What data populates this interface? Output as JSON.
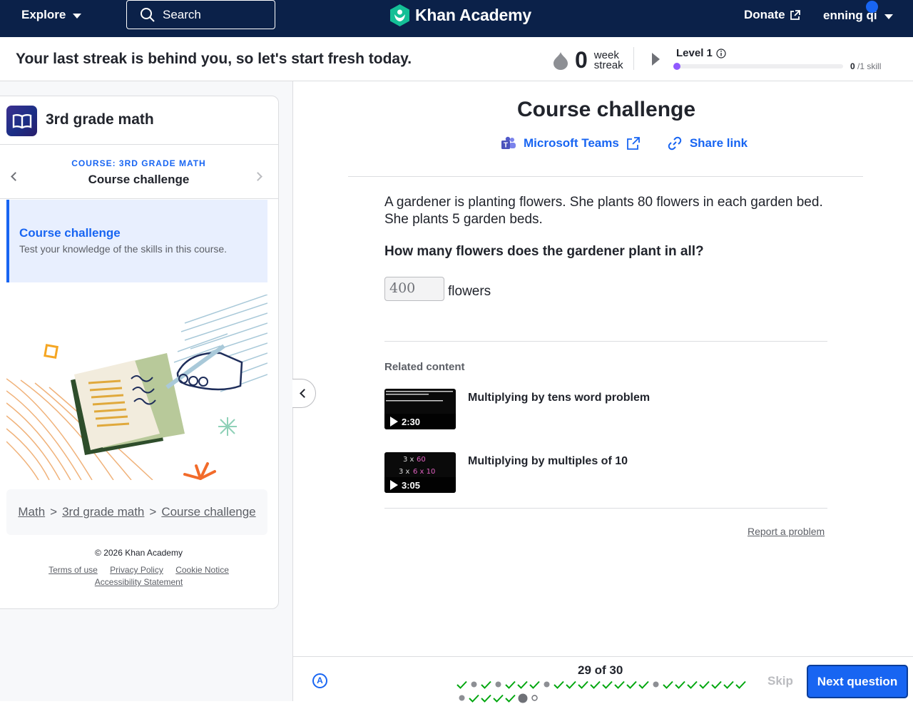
{
  "nav": {
    "explore": "Explore",
    "search_placeholder": "Search",
    "logo": "Khan Academy",
    "donate": "Donate",
    "user": "enning qi"
  },
  "streak": {
    "message": "Your last streak is behind you, so let's start fresh today.",
    "count": "0",
    "unit_line1": "week",
    "unit_line2": "streak",
    "level": "Level 1",
    "level_progress_fraction": 0,
    "skills_done": "0",
    "skills_total": "/1 skill"
  },
  "sidebar": {
    "course_name": "3rd grade math",
    "kicker": "COURSE: 3RD GRADE MATH",
    "subtitle": "Course challenge",
    "active_title": "Course challenge",
    "active_desc": "Test your knowledge of the skills in this course.",
    "breadcrumbs": [
      "Math",
      "3rd grade math",
      "Course challenge"
    ],
    "crumb_sep": ">",
    "copyright": "© 2026 Khan Academy",
    "links": [
      "Terms of use",
      "Privacy Policy",
      "Cookie Notice",
      "Accessibility Statement"
    ]
  },
  "main": {
    "title": "Course challenge",
    "share_teams": "Microsoft Teams",
    "share_link": "Share link",
    "problem_line1": "A gardener is planting flowers. She plants 80 flowers in each garden bed.",
    "problem_line2": "She plants 5 garden beds.",
    "question": "How many flowers does the gardener plant in all?",
    "answer_value": "400",
    "answer_unit": "flowers",
    "related_heading": "Related content",
    "videos": [
      {
        "title": "Multiplying by tens word problem",
        "duration": "2:30"
      },
      {
        "title": "Multiplying by multiples of 10",
        "duration": "3:05"
      }
    ],
    "report": "Report a problem"
  },
  "bottom": {
    "counter": "29 of 30",
    "skip": "Skip",
    "next": "Next question",
    "progress": [
      "check",
      "dot",
      "check",
      "dot",
      "check",
      "check",
      "check",
      "dot",
      "check",
      "check",
      "check",
      "check",
      "check",
      "check",
      "check",
      "check",
      "dot",
      "check",
      "check",
      "check",
      "check",
      "check",
      "check",
      "check",
      "dot",
      "check",
      "check",
      "check",
      "check",
      "current",
      "empty"
    ]
  },
  "colors": {
    "navy": "#0b2149",
    "blue": "#1865f2",
    "green": "#00a60e",
    "purple": "#9059ff"
  }
}
